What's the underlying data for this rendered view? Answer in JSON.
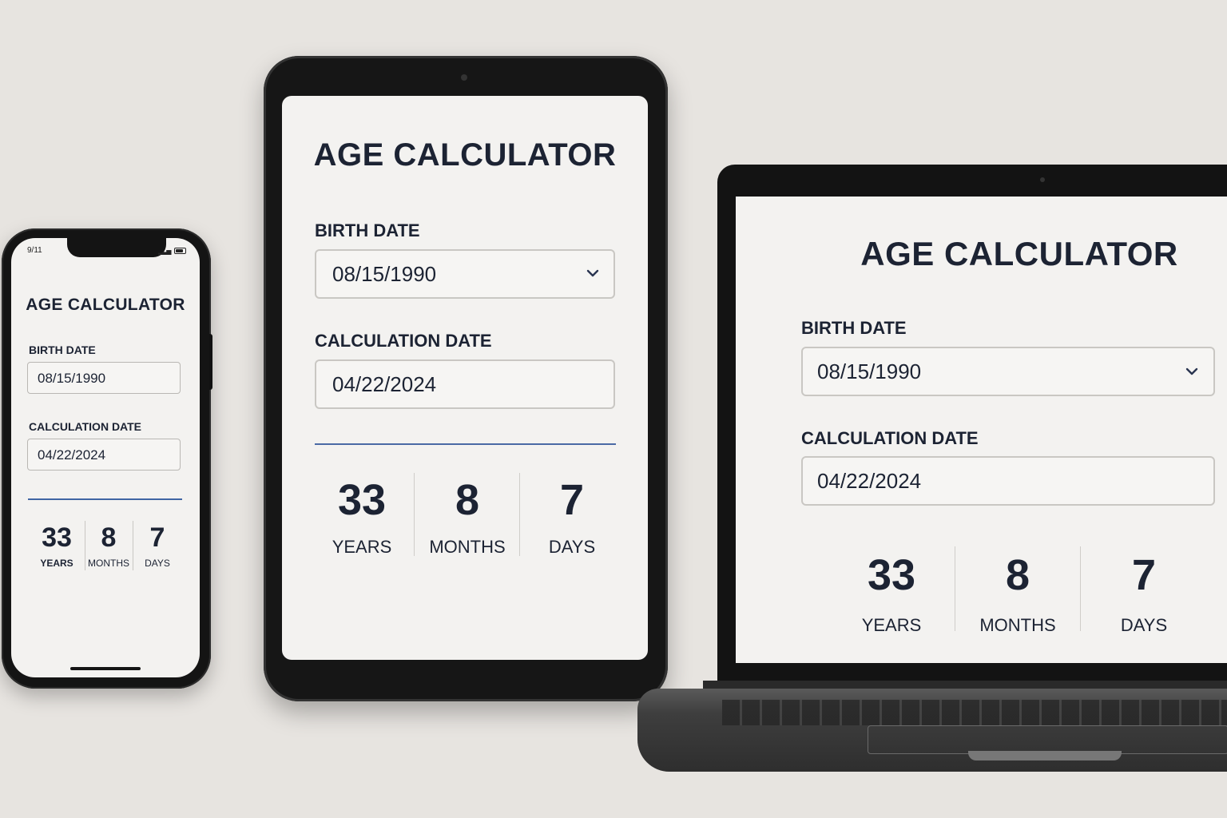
{
  "app": {
    "title": "AGE CALCULATOR",
    "birth_label": "BIRTH DATE",
    "birth_value": "08/15/1990",
    "calc_label": "CALCULATION DATE",
    "calc_value": "04/22/2024"
  },
  "result": {
    "years": "33",
    "years_label": "YEARS",
    "months": "8",
    "months_label": "MONTHS",
    "days": "7",
    "days_label": "DAYS"
  },
  "phone_status": {
    "time": "9/11"
  },
  "colors": {
    "accent_rule": "#3f65a3",
    "text": "#1c2333",
    "screen_bg": "#f3f2f0",
    "device_frame": "#141414"
  }
}
